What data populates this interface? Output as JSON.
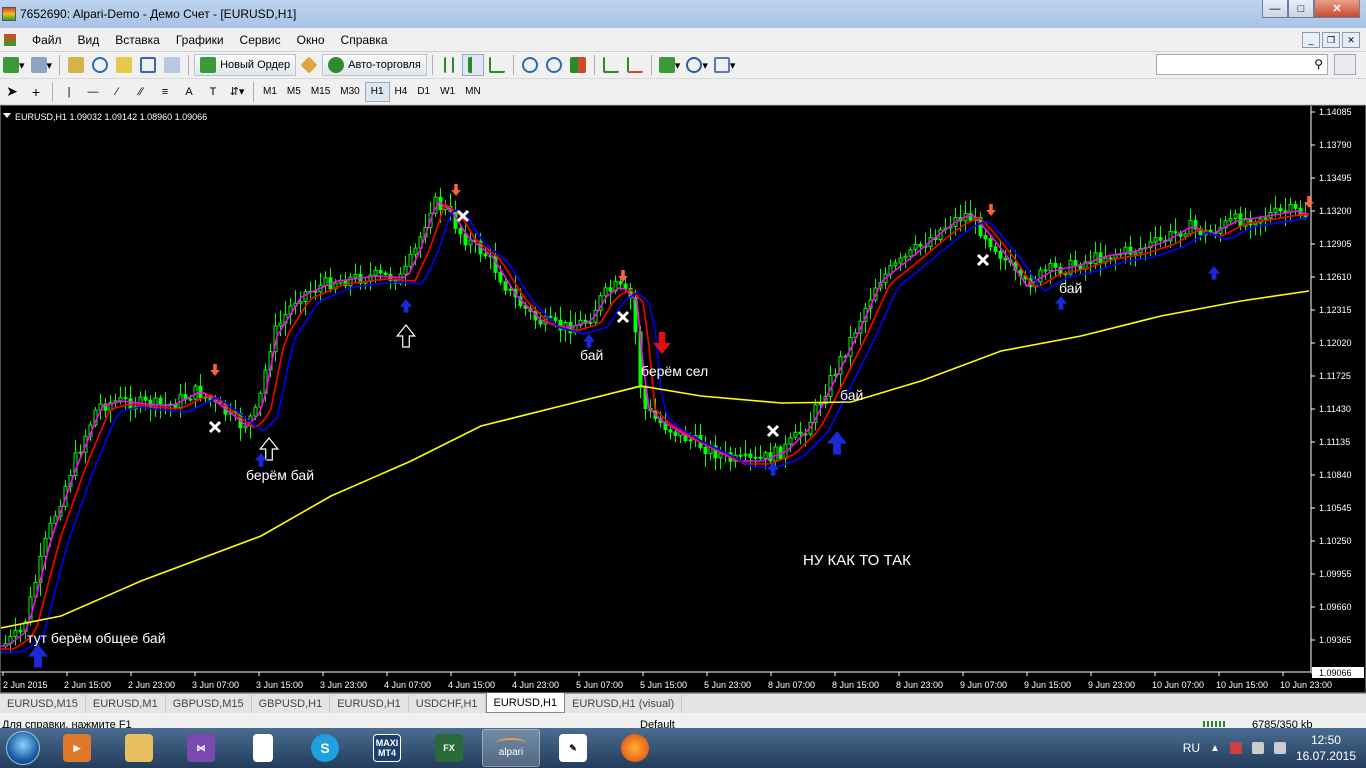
{
  "window": {
    "title": "7652690: Alpari-Demo - Демо Счет - [EURUSD,H1]"
  },
  "menu": [
    "Файл",
    "Вид",
    "Вставка",
    "Графики",
    "Сервис",
    "Окно",
    "Справка"
  ],
  "toolbar": {
    "new_order_label": "Новый Ордер",
    "autotrading_label": "Авто-торговля",
    "timeframes": [
      "M1",
      "M5",
      "M15",
      "M30",
      "H1",
      "H4",
      "D1",
      "W1",
      "MN"
    ],
    "active_timeframe": "H1"
  },
  "chart": {
    "header": "EURUSD,H1  1.09032 1.09142 1.08960 1.09066",
    "price_labels": [
      "1.14085",
      "1.13790",
      "1.13495",
      "1.13200",
      "1.12905",
      "1.12610",
      "1.12315",
      "1.12020",
      "1.11725",
      "1.11430",
      "1.11135",
      "1.10840",
      "1.10545",
      "1.10250",
      "1.09955",
      "1.09660",
      "1.09365",
      "1.09066"
    ],
    "current_price": "1.09066",
    "time_labels": [
      "2 Jun 2015",
      "2 Jun 15:00",
      "2 Jun 23:00",
      "3 Jun 07:00",
      "3 Jun 15:00",
      "3 Jun 23:00",
      "4 Jun 07:00",
      "4 Jun 15:00",
      "4 Jun 23:00",
      "5 Jun 07:00",
      "5 Jun 15:00",
      "5 Jun 23:00",
      "8 Jun 07:00",
      "8 Jun 15:00",
      "8 Jun 23:00",
      "9 Jun 07:00",
      "9 Jun 15:00",
      "9 Jun 23:00",
      "10 Jun 07:00",
      "10 Jun 15:00",
      "10 Jun 23:00"
    ],
    "annotations": {
      "general_buy": "тут берём общее бай",
      "take_buy": "берём бай",
      "buy_1": "бай",
      "take_sell": "берём сел",
      "buy_2": "бай",
      "buy_3": "бай",
      "comment": "НУ КАК ТО ТАК"
    },
    "colors": {
      "background": "#000000",
      "candles": "#00ff00",
      "ma_fast": "#ff00ff",
      "ma_mid": "#ff0000",
      "ma_slow": "#0000ff",
      "ma_long": "#ffff00"
    }
  },
  "tabs": [
    "EURUSD,M15",
    "EURUSD,M1",
    "GBPUSD,M15",
    "GBPUSD,H1",
    "EURUSD,H1",
    "USDCHF,H1",
    "EURUSD,H1",
    "EURUSD,H1 (visual)"
  ],
  "active_tab": 6,
  "status": {
    "help": "Для справки, нажмите F1",
    "profile": "Default",
    "traffic": "6785/350 kb"
  },
  "taskbar": {
    "apps": [
      "media-player",
      "file-explorer",
      "visual-studio",
      "document",
      "skype",
      "maxi-mt4",
      "forex-app",
      "alpari",
      "notepad",
      "firefox"
    ],
    "alpari_label": "alpari",
    "maxi_label": "MAXI MT4",
    "language": "RU",
    "time": "12:50",
    "date": "16.07.2015"
  }
}
